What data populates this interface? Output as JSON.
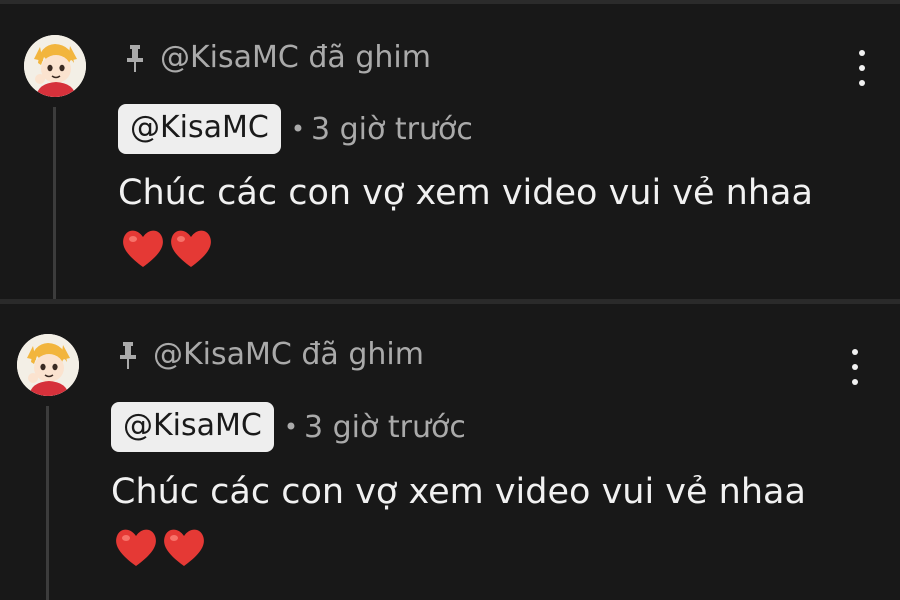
{
  "comments": [
    {
      "pinned_text": "@KisaMC đã ghim",
      "author": "@KisaMC",
      "separator": "•",
      "time": "3 giờ trước",
      "text": "Chúc các con vợ xem video vui vẻ nhaa",
      "emoji": "heart-emoji x2",
      "menu_icon": "more-vert-icon",
      "pin_icon": "pin-icon"
    },
    {
      "pinned_text": "@KisaMC đã ghim",
      "author": "@KisaMC",
      "separator": "•",
      "time": "3 giờ trước",
      "text": "Chúc các con vợ xem video vui vẻ nhaa",
      "emoji": "heart-emoji x2",
      "menu_icon": "more-vert-icon",
      "pin_icon": "pin-icon"
    }
  ],
  "colors": {
    "background": "#181818",
    "muted_text": "#aaaaaa",
    "body_text": "#f1f1f1",
    "author_chip_bg": "#eeeeee",
    "heart": "#e53935"
  }
}
